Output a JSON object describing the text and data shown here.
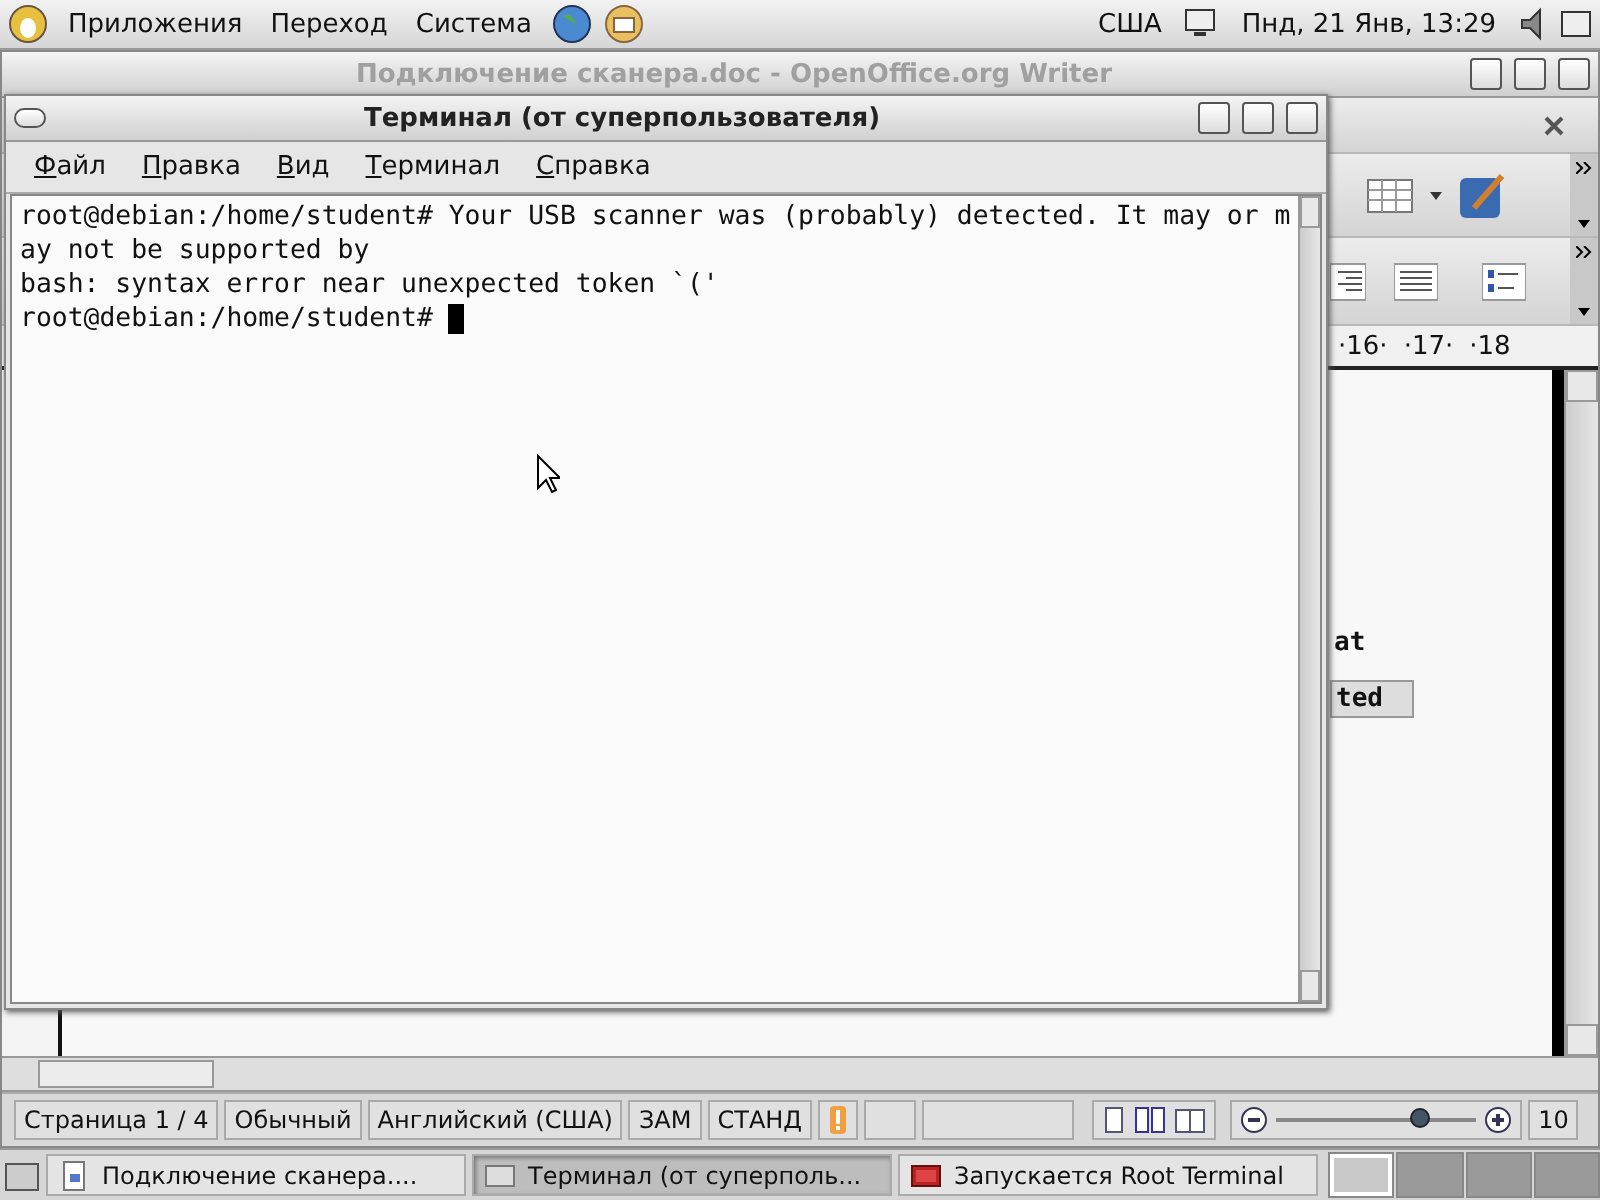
{
  "top_panel": {
    "menus": [
      "Приложения",
      "Переход",
      "Система"
    ],
    "keyboard_layout": "США",
    "clock": "Пнд, 21 Янв, 13:29"
  },
  "writer_window": {
    "title": "Подключение сканера.doc - OpenOffice.org Writer",
    "ruler_labels": [
      "·16·",
      "·17·",
      "·18"
    ],
    "document_fragments": [
      {
        "text": "at",
        "kind": "plain"
      },
      {
        "text": "ted",
        "kind": "cell"
      }
    ],
    "status_bar": [
      {
        "text": "Страница  1 / 4",
        "kind": "text"
      },
      {
        "text": "Обычный",
        "kind": "text"
      },
      {
        "text": "Английский (США)",
        "kind": "text"
      },
      {
        "text": "ЗАМ",
        "kind": "text"
      },
      {
        "text": "СТАНД",
        "kind": "text"
      },
      {
        "kind": "warning"
      },
      {
        "kind": "empty"
      },
      {
        "kind": "wide"
      },
      {
        "kind": "views"
      },
      {
        "kind": "zoom",
        "level": 0.72
      },
      {
        "text": "10",
        "kind": "text"
      }
    ]
  },
  "terminal_window": {
    "title": "Терминал (от суперпользователя)",
    "menus": [
      "Файл",
      "Правка",
      "Вид",
      "Терминал",
      "Справка"
    ],
    "lines": [
      "root@debian:/home/student# Your USB scanner was (probably) detected. It may or m",
      "ay not be supported by",
      "bash: syntax error near unexpected token `('",
      "root@debian:/home/student# "
    ]
  },
  "taskbar": {
    "tasks": [
      {
        "label": "Подключение сканера....",
        "kind": "document",
        "selected": false
      },
      {
        "label": "Терминал (от суперполь...",
        "kind": "window",
        "selected": true
      },
      {
        "label": "Запускается Root Terminal",
        "kind": "terminal",
        "selected": false
      }
    ],
    "workspaces": [
      {
        "selected": true
      },
      {
        "selected": false
      },
      {
        "selected": false
      },
      {
        "selected": false
      }
    ]
  }
}
